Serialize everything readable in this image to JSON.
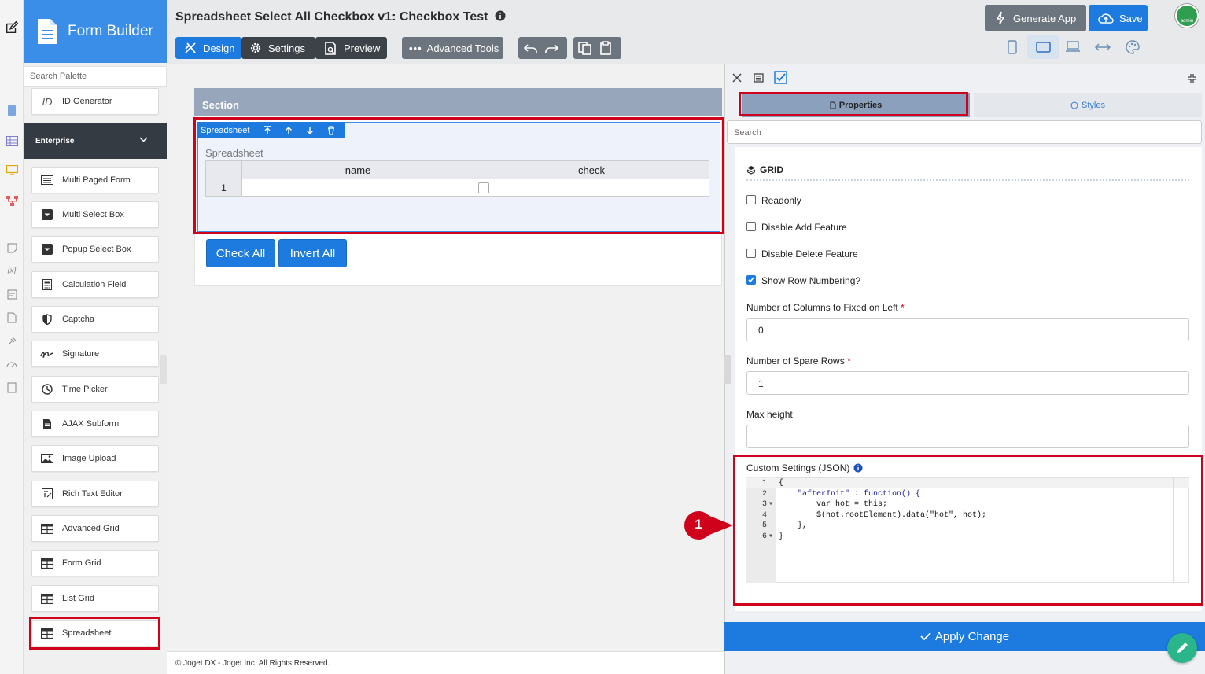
{
  "header": {
    "brand": "Form Builder",
    "title": "Spreadsheet Select All Checkbox v1: Checkbox Test",
    "tabs": [
      "Design",
      "Settings",
      "Preview"
    ],
    "advanced_tools": "Advanced Tools",
    "generate_app": "Generate App",
    "save": "Save",
    "avatar_text": "admin"
  },
  "palette": {
    "search_placeholder": "Search Palette",
    "id_generator": "ID Generator",
    "category": "Enterprise",
    "items": [
      "Multi Paged Form",
      "Multi Select Box",
      "Popup Select Box",
      "Calculation Field",
      "Captcha",
      "Signature",
      "Time Picker",
      "AJAX Subform",
      "Image Upload",
      "Rich Text Editor",
      "Advanced Grid",
      "Form Grid",
      "List Grid",
      "Spreadsheet"
    ]
  },
  "canvas": {
    "section_title": "Section",
    "element_toolbar_label": "Spreadsheet",
    "spreadsheet_label": "Spreadsheet",
    "columns": [
      "name",
      "check"
    ],
    "row_number": "1",
    "buttons": [
      "Check All",
      "Invert All"
    ],
    "footer": "© Joget DX - Joget Inc. All Rights Reserved."
  },
  "properties": {
    "tabs": [
      "Properties",
      "Styles"
    ],
    "search_placeholder": "Search",
    "group_title": "GRID",
    "checkboxes": [
      {
        "label": "Readonly",
        "checked": false
      },
      {
        "label": "Disable Add Feature",
        "checked": false
      },
      {
        "label": "Disable Delete Feature",
        "checked": false
      },
      {
        "label": "Show Row Numbering?",
        "checked": true
      }
    ],
    "fixed_columns_label": "Number of Columns to Fixed on Left",
    "fixed_columns_value": "0",
    "spare_rows_label": "Number of Spare Rows",
    "spare_rows_value": "1",
    "max_height_label": "Max height",
    "max_height_value": "",
    "required_mark": "*",
    "custom_settings_label": "Custom Settings (JSON)",
    "code_lines": [
      "{",
      "    \"afterInit\" : function() {",
      "        var hot = this;",
      "        $(hot.rootElement).data(\"hot\", hot);",
      "    },",
      "}"
    ],
    "line_numbers": [
      "1",
      "2",
      "3",
      "4",
      "5",
      "6"
    ],
    "apply": "Apply Change"
  },
  "annotation": {
    "marker": "1"
  },
  "colors": {
    "primary": "#3b8ee8",
    "apply": "#1d7be0",
    "highlight": "#d0021b",
    "header_dark": "#3d4249"
  }
}
